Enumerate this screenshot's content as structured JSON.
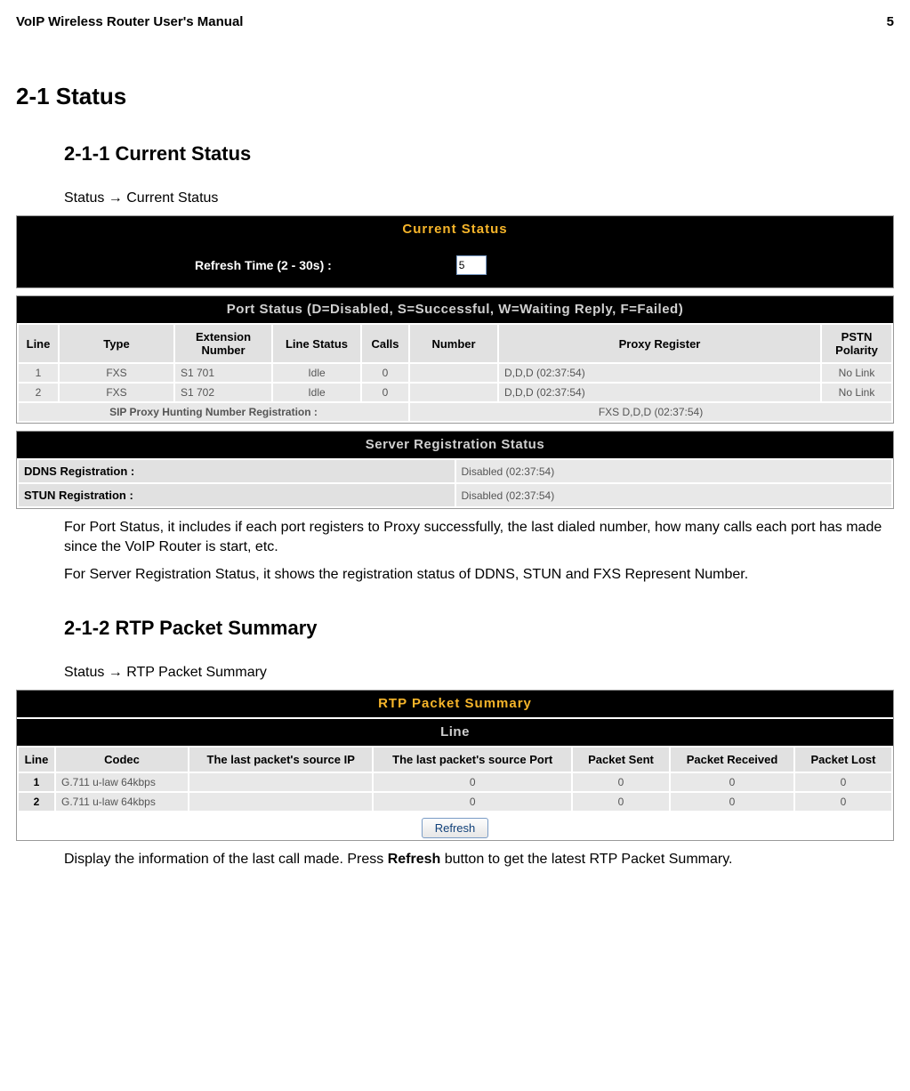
{
  "doc": {
    "header_title": "VoIP Wireless Router User's Manual",
    "page_number": "5"
  },
  "sec": {
    "h1": "2-1   Status",
    "h2a": "2-1-1 Current Status",
    "bca": "Status  →  Current Status",
    "h2b": "2-1-2 RTP Packet Summary",
    "bcb": "Status  →   RTP Packet Summary",
    "para1": "For Port Status, it includes if each port registers to Proxy successfully, the last dialed number, how many calls each port has made since the VoIP Router is start, etc.",
    "para2": "For Server Registration Status, it shows the registration status of DDNS, STUN and FXS Represent Number.",
    "para3a": "Display the information of the last call made. Press ",
    "para3b": "Refresh",
    "para3c": " button to get the latest RTP Packet Summary."
  },
  "current_status": {
    "title": "Current Status",
    "refresh_label": "Refresh Time (2 - 30s) :",
    "refresh_value": "5",
    "port_status_title": "Port Status (D=Disabled, S=Successful, W=Waiting Reply, F=Failed)",
    "headers": {
      "line": "Line",
      "type": "Type",
      "ext": "Extension Number",
      "status": "Line Status",
      "calls": "Calls",
      "number": "Number",
      "proxy": "Proxy Register",
      "pstn": "PSTN Polarity"
    },
    "rows": [
      {
        "line": "1",
        "type": "FXS",
        "ext": "S1 701",
        "status": "Idle",
        "calls": "0",
        "number": "",
        "proxy": "D,D,D (02:37:54)",
        "pstn": "No Link"
      },
      {
        "line": "2",
        "type": "FXS",
        "ext": "S1 702",
        "status": "Idle",
        "calls": "0",
        "number": "",
        "proxy": "D,D,D (02:37:54)",
        "pstn": "No Link"
      }
    ],
    "hunting_label": "SIP Proxy Hunting Number Registration :",
    "hunting_value": "FXS D,D,D (02:37:54)",
    "server_reg_title": "Server Registration Status",
    "ddns_label": "DDNS Registration :",
    "ddns_value": "Disabled (02:37:54)",
    "stun_label": "STUN Registration :",
    "stun_value": "Disabled (02:37:54)"
  },
  "rtp": {
    "title": "RTP Packet Summary",
    "sub_title": "Line",
    "headers": {
      "line": "Line",
      "codec": "Codec",
      "src_ip": "The last packet's source IP",
      "src_port": "The last packet's source Port",
      "sent": "Packet Sent",
      "recv": "Packet Received",
      "lost": "Packet Lost"
    },
    "rows": [
      {
        "line": "1",
        "codec": "G.711 u-law 64kbps",
        "src_ip": "",
        "src_port": "0",
        "sent": "0",
        "recv": "0",
        "lost": "0"
      },
      {
        "line": "2",
        "codec": "G.711 u-law 64kbps",
        "src_ip": "",
        "src_port": "0",
        "sent": "0",
        "recv": "0",
        "lost": "0"
      }
    ],
    "refresh_button": "Refresh"
  }
}
